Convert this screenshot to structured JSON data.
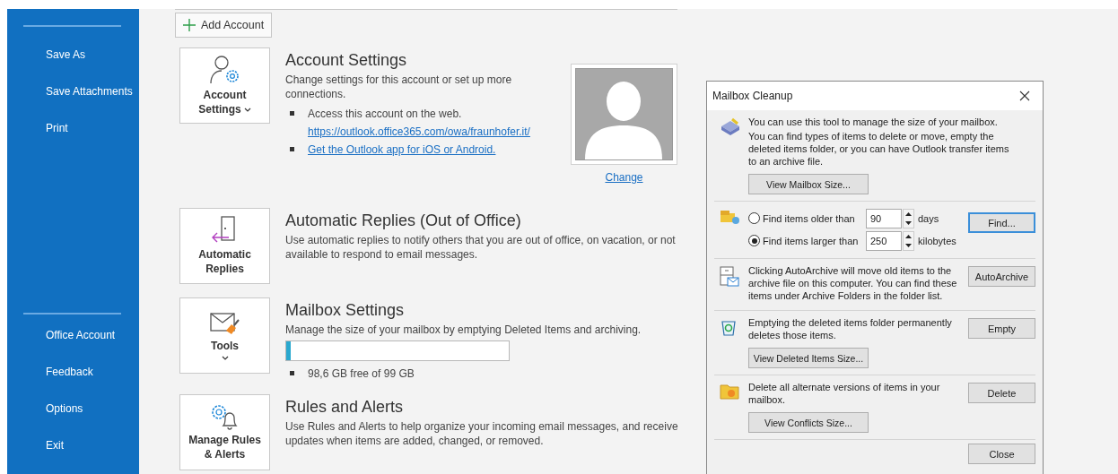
{
  "sidebar": {
    "top_items": [
      {
        "label": "Save As"
      },
      {
        "label": "Save Attachments"
      },
      {
        "label": "Print"
      }
    ],
    "bottom_items": [
      {
        "label": "Office Account"
      },
      {
        "label": "Feedback"
      },
      {
        "label": "Options"
      },
      {
        "label": "Exit"
      }
    ]
  },
  "add_account_button": "Add Account",
  "sections": [
    {
      "kind": "account",
      "tile": {
        "label": "Account Settings",
        "dropdown": true
      },
      "title": "Account Settings",
      "description": "Change settings for this account or set up more connections.",
      "bullets": [
        {
          "text": "Access this account on the web.",
          "link": "https://outlook.office365.com/owa/fraunhofer.it/"
        },
        {
          "link": "Get the Outlook app for iOS or Android."
        }
      ],
      "photo_link": "Change"
    },
    {
      "kind": "auto",
      "tile": {
        "label": "Automatic Replies",
        "dropdown": false
      },
      "title": "Automatic Replies (Out of Office)",
      "description": "Use automatic replies to notify others that you are out of office, on vacation, or not available to respond to email messages."
    },
    {
      "kind": "mailbox",
      "tile": {
        "label": "Tools",
        "dropdown": true
      },
      "title": "Mailbox Settings",
      "description": "Manage the size of your mailbox by emptying Deleted Items and archiving.",
      "level": 0.02,
      "bullets": [
        {
          "text": "98,6 GB free of 99 GB"
        }
      ]
    },
    {
      "kind": "rules",
      "tile": {
        "label": "Manage Rules & Alerts",
        "dropdown": false
      },
      "title": "Rules and Alerts",
      "description": "Use Rules and Alerts to help organize your incoming email messages, and receive updates when items are added, changed, or removed."
    }
  ],
  "dialog": {
    "title": "Mailbox Cleanup",
    "sections": [
      {
        "kind": "intro",
        "texts": [
          "You can use this tool to manage the size of your mailbox.",
          "You can find types of items to delete or move, empty the deleted items folder, or you can have Outlook transfer items to an archive file."
        ],
        "sub_button": "View Mailbox Size..."
      },
      {
        "kind": "find",
        "options": [
          {
            "label": "Find items older than",
            "selected": false,
            "value": "90",
            "unit": "days"
          },
          {
            "label": "Find items larger than",
            "selected": true,
            "value": "250",
            "unit": "kilobytes"
          }
        ],
        "button": "Find..."
      },
      {
        "kind": "archive",
        "texts": [
          "Clicking AutoArchive will move old items to the archive file on this computer. You can find these items under Archive Folders in the folder list."
        ],
        "button": "AutoArchive"
      },
      {
        "kind": "empty",
        "texts": [
          "Emptying the deleted items folder permanently deletes those items."
        ],
        "button": "Empty",
        "sub_button": "View Deleted Items Size..."
      },
      {
        "kind": "conflicts",
        "texts": [
          "Delete all alternate versions of items in your mailbox."
        ],
        "button": "Delete",
        "sub_button": "View Conflicts Size..."
      }
    ],
    "close_button": "Close"
  }
}
